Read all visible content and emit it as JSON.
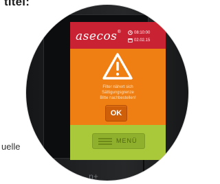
{
  "page": {
    "top_text": "titel:",
    "side_text": "uelle"
  },
  "device": {
    "connector_glyph": "n+"
  },
  "screen": {
    "logo": "asecos",
    "logo_mark": "®",
    "time": "08:10:00",
    "date": "02.02.15",
    "icons": {
      "time": "clock-icon",
      "date": "calendar-icon",
      "warning": "warning-icon",
      "menu": "hamburger-icon"
    },
    "warning": {
      "message_lines": [
        "Filter nähert sich",
        "Sättigungsgrenze",
        "Bitte nachbestellen!"
      ],
      "ok_label": "OK"
    },
    "menu_label": "MENÜ",
    "colors": {
      "header": "#c92233",
      "warning_background": "#f07f13",
      "ok_button": "#d05f0a",
      "menu_bar": "#a9c93b",
      "menu_button": "#8fb02c"
    }
  }
}
